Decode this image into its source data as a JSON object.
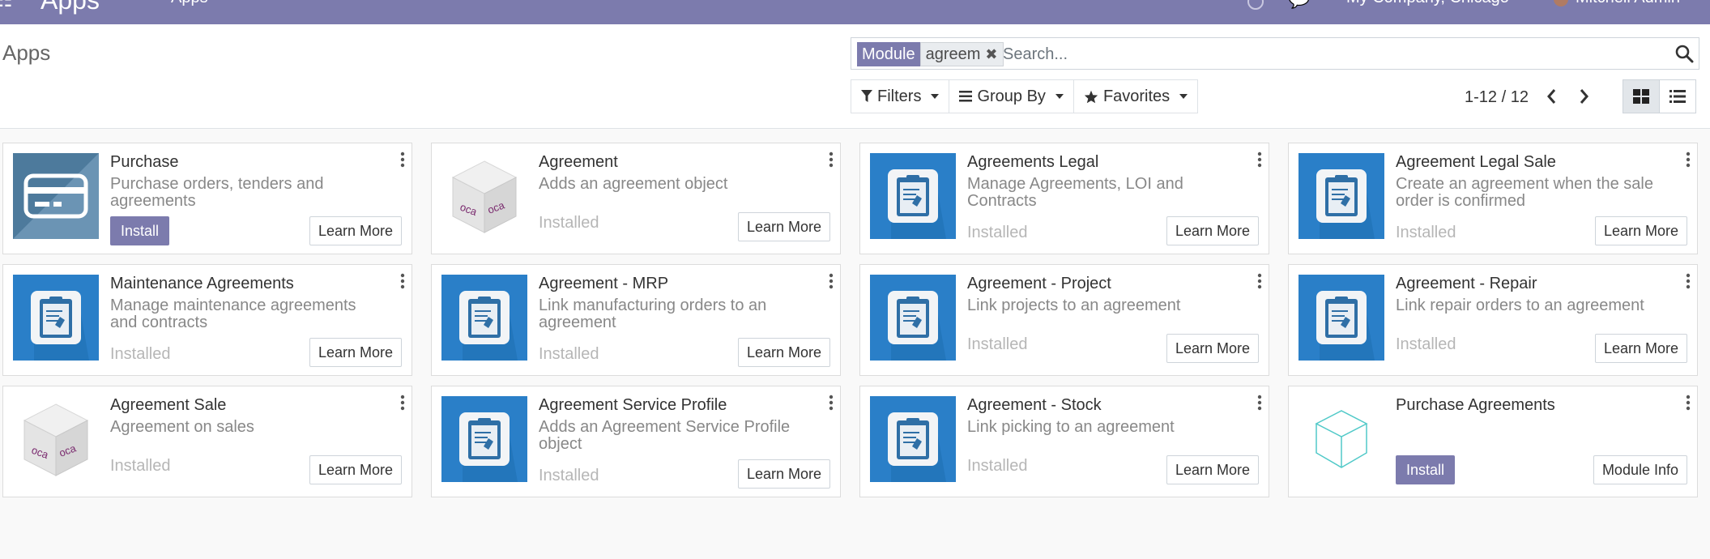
{
  "navbar": {
    "brand": "Apps",
    "menu_apps": "Apps",
    "company": "My Company, Chicago",
    "user": "Mitchell Admin",
    "color": "#7c7bad"
  },
  "control_panel": {
    "title": "Apps",
    "search": {
      "facet_label": "Module",
      "facet_value": "agreem",
      "placeholder": "Search..."
    },
    "filters_label": "Filters",
    "groupby_label": "Group By",
    "favorites_label": "Favorites",
    "pager": "1-12 / 12"
  },
  "apps": [
    {
      "title": "Purchase",
      "summary": "Purchase orders, tenders and agreements",
      "status": "",
      "action": "Install",
      "more": "Learn More",
      "icon": "purchase-icon"
    },
    {
      "title": "Agreement",
      "summary": "Adds an agreement object",
      "status": "Installed",
      "action": "",
      "more": "Learn More",
      "icon": "oca-cube-icon"
    },
    {
      "title": "Agreements Legal",
      "summary": "Manage Agreements, LOI and Contracts",
      "status": "Installed",
      "action": "",
      "more": "Learn More",
      "icon": "clipboard-icon"
    },
    {
      "title": "Agreement Legal Sale",
      "summary": "Create an agreement when the sale order is confirmed",
      "status": "Installed",
      "action": "",
      "more": "Learn More",
      "icon": "clipboard-icon"
    },
    {
      "title": "Maintenance Agreements",
      "summary": "Manage maintenance agreements and contracts",
      "status": "Installed",
      "action": "",
      "more": "Learn More",
      "icon": "clipboard-icon"
    },
    {
      "title": "Agreement - MRP",
      "summary": "Link manufacturing orders to an agreement",
      "status": "Installed",
      "action": "",
      "more": "Learn More",
      "icon": "clipboard-icon"
    },
    {
      "title": "Agreement - Project",
      "summary": "Link projects to an agreement",
      "status": "Installed",
      "action": "",
      "more": "Learn More",
      "icon": "clipboard-icon"
    },
    {
      "title": "Agreement - Repair",
      "summary": "Link repair orders to an agreement",
      "status": "Installed",
      "action": "",
      "more": "Learn More",
      "icon": "clipboard-icon"
    },
    {
      "title": "Agreement Sale",
      "summary": "Agreement on sales",
      "status": "Installed",
      "action": "",
      "more": "Learn More",
      "icon": "oca-cube-icon"
    },
    {
      "title": "Agreement Service Profile",
      "summary": "Adds an Agreement Service Profile object",
      "status": "Installed",
      "action": "",
      "more": "Learn More",
      "icon": "clipboard-icon"
    },
    {
      "title": "Agreement - Stock",
      "summary": "Link picking to an agreement",
      "status": "Installed",
      "action": "",
      "more": "Learn More",
      "icon": "clipboard-icon"
    },
    {
      "title": "Purchase Agreements",
      "summary": "",
      "status": "",
      "action": "Install",
      "more": "Module Info",
      "icon": "outline-cube-icon"
    }
  ]
}
